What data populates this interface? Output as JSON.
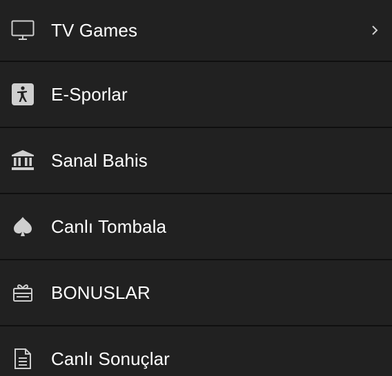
{
  "menu": {
    "items": [
      {
        "label": "TV Games",
        "icon": "tv-icon",
        "has_submenu": true
      },
      {
        "label": "E-Sporlar",
        "icon": "counter-strike-icon",
        "has_submenu": false
      },
      {
        "label": "Sanal Bahis",
        "icon": "bank-icon",
        "has_submenu": false
      },
      {
        "label": "Canlı Tombala",
        "icon": "spade-icon",
        "has_submenu": false
      },
      {
        "label": "BONUSLAR",
        "icon": "gift-card-icon",
        "has_submenu": false
      },
      {
        "label": "Canlı Sonuçlar",
        "icon": "document-icon",
        "has_submenu": false
      }
    ]
  },
  "colors": {
    "background": "#212121",
    "divider": "#0f0f0f",
    "text": "#ffffff",
    "icon": "#cfcfcf"
  }
}
